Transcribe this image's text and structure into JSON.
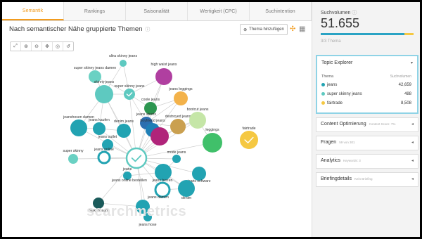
{
  "tabs": [
    {
      "label": "Semantik",
      "active": true
    },
    {
      "label": "Rankings",
      "active": false
    },
    {
      "label": "Saisonalität",
      "active": false
    },
    {
      "label": "Wertigkeit (CPC)",
      "active": false
    },
    {
      "label": "Suchintention",
      "active": false
    }
  ],
  "header": {
    "title": "Nach semantischer Nähe gruppierte Themen",
    "add_button": "Thema hinzufügen"
  },
  "graph_nodes": [
    {
      "id": "ultra",
      "label": "ultra skinny jeans",
      "color": "#5ec9c0"
    },
    {
      "id": "high",
      "label": "high waist jeans",
      "color": "#b03fa0"
    },
    {
      "id": "skdamen",
      "label": "super skinny jeans damen",
      "color": "#6ad1c3"
    },
    {
      "id": "skinny",
      "label": "skinny jeans",
      "color": "#5ec9c0"
    },
    {
      "id": "superskinny",
      "label": "super skinny jeans",
      "color": "#5ec9c0"
    },
    {
      "id": "leggings",
      "label": "jeans leggings",
      "color": "#f3b24a"
    },
    {
      "id": "coole",
      "label": "coole jeans",
      "color": "#2c9650"
    },
    {
      "id": "shorts",
      "label": "jeans shorts",
      "color": "#2c6fb0"
    },
    {
      "id": "destroyed",
      "label": "destroyed jeans",
      "color": "#caa050"
    },
    {
      "id": "bootcut",
      "label": "bootcut jeans",
      "color": "#c5e6a7"
    },
    {
      "id": "jhdamen",
      "label": "jeanshosen damen",
      "color": "#22a3b2"
    },
    {
      "id": "kaufen",
      "label": "jeans kaufen",
      "color": "#22a3b2"
    },
    {
      "id": "denimjeans",
      "label": "denim jeans",
      "color": "#22a3b2"
    },
    {
      "id": "boyfriend",
      "label": "boyfriend jeans",
      "color": "#1f7fb6"
    },
    {
      "id": "magenta",
      "label": "",
      "color": "#b0247a"
    },
    {
      "id": "leggings2",
      "label": "leggings",
      "color": "#40c06a"
    },
    {
      "id": "fairtrade",
      "label": "fairtrade",
      "color": "#f5c842"
    },
    {
      "id": "outlet",
      "label": "jeans outlet",
      "color": "#22a3b2"
    },
    {
      "id": "online",
      "label": "jeans online",
      "color": "#22a3b2"
    },
    {
      "id": "superskinny2",
      "label": "super skinny",
      "color": "#6ad1c3"
    },
    {
      "id": "jeans",
      "label": "",
      "color": "#5ec9c0"
    },
    {
      "id": "mode",
      "label": "mode jeans",
      "color": "#22a3b2"
    },
    {
      "id": "jeans2",
      "label": "jeans",
      "color": "#22a3b2"
    },
    {
      "id": "bestellen",
      "label": "jeans online bestellen",
      "color": "#22a3b2"
    },
    {
      "id": "herren",
      "label": "jeans herren",
      "color": "#22a3b2"
    },
    {
      "id": "schwarz",
      "label": "jeans schwarz",
      "color": "#22a3b2"
    },
    {
      "id": "denim",
      "label": "denim",
      "color": "#22a3b2"
    },
    {
      "id": "jdamen",
      "label": "jeans damen",
      "color": "#22a3b2"
    },
    {
      "id": "marken",
      "label": "marken jeans",
      "color": "#1a5a5a"
    },
    {
      "id": "hose",
      "label": "jeans hose",
      "color": "#22a3b2"
    }
  ],
  "watermark": "searchmetrics",
  "sidebar": {
    "volume_label": "Suchvolumen",
    "volume_value": "51.655",
    "volume_sub": "3/3 Thema",
    "volume_split": [
      0.9,
      0.1
    ],
    "topic_explorer": {
      "title": "Topic Explorer",
      "col_theme": "Thema",
      "col_volume": "Suchvolumen",
      "rows": [
        {
          "name": "jeans",
          "value": "42,659",
          "color": "#22a3b2"
        },
        {
          "name": "super skinny jeans",
          "value": "488",
          "color": "#5ec9c0"
        },
        {
          "name": "fairtrade",
          "value": "8,508",
          "color": "#f5c842"
        }
      ]
    },
    "sections": [
      {
        "title": "Content Optimierung",
        "sub": "Content Score: 7%"
      },
      {
        "title": "Fragen",
        "sub": "59 von 301"
      },
      {
        "title": "Analytics",
        "sub": "Keywords: 3"
      },
      {
        "title": "Briefingdetails",
        "sub": "Kein Briefing"
      }
    ]
  },
  "colors": {
    "accent": "#f29c1f",
    "teal": "#22a3b2"
  }
}
